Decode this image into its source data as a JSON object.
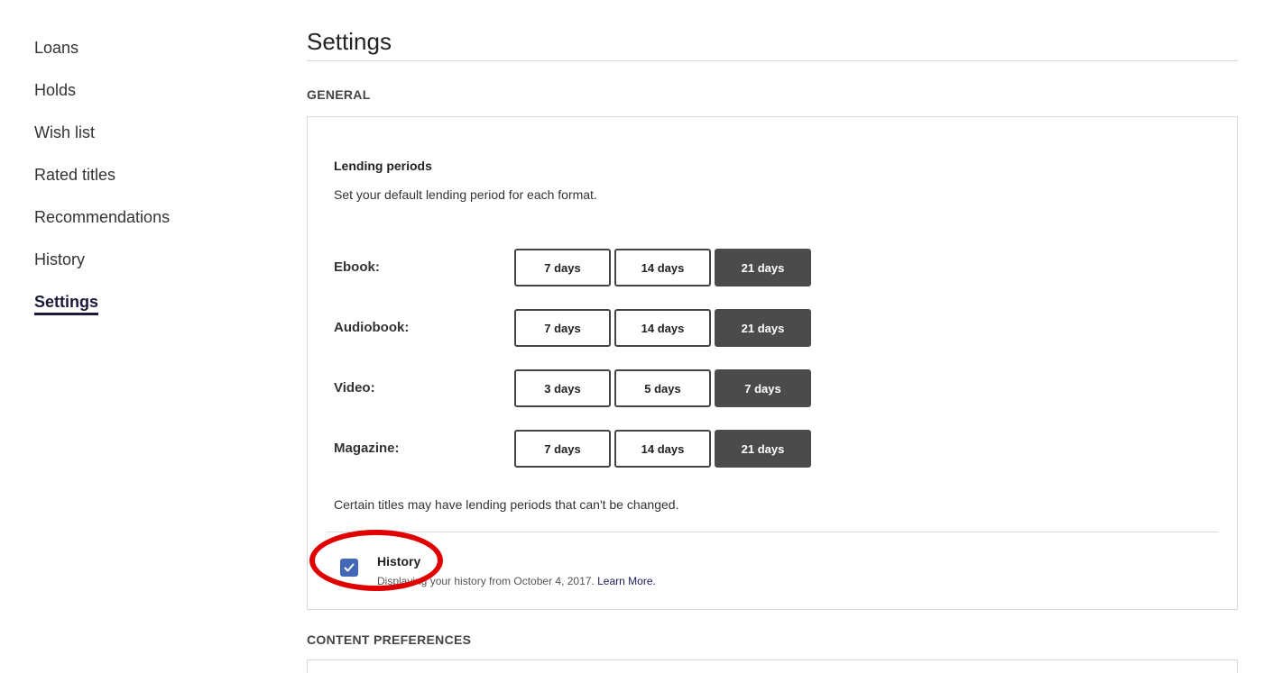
{
  "sidebar": {
    "items": [
      {
        "label": "Loans"
      },
      {
        "label": "Holds"
      },
      {
        "label": "Wish list"
      },
      {
        "label": "Rated titles"
      },
      {
        "label": "Recommendations"
      },
      {
        "label": "History"
      },
      {
        "label": "Settings"
      }
    ],
    "active": "Settings"
  },
  "main": {
    "title": "Settings",
    "general_heading": "GENERAL",
    "lending": {
      "title": "Lending periods",
      "description": "Set your default lending period for each format.",
      "rows": [
        {
          "format": "Ebook:",
          "options": [
            "7 days",
            "14 days",
            "21 days"
          ],
          "selected": "21 days"
        },
        {
          "format": "Audiobook:",
          "options": [
            "7 days",
            "14 days",
            "21 days"
          ],
          "selected": "21 days"
        },
        {
          "format": "Video:",
          "options": [
            "3 days",
            "5 days",
            "7 days"
          ],
          "selected": "7 days"
        },
        {
          "format": "Magazine:",
          "options": [
            "7 days",
            "14 days",
            "21 days"
          ],
          "selected": "21 days"
        }
      ],
      "note": "Certain titles may have lending periods that can't be changed."
    },
    "history": {
      "label": "History",
      "checked": true,
      "description": "Displaying your history from October 4, 2017.",
      "link": "Learn More."
    },
    "content_heading": "CONTENT PREFERENCES"
  },
  "colors": {
    "selected_button": "#4b4b4b",
    "checkbox": "#4468b8",
    "highlight_ring": "#e00000",
    "active_nav": "#1b1a3a"
  },
  "icons": {
    "checkbox": "checkmark-icon"
  }
}
